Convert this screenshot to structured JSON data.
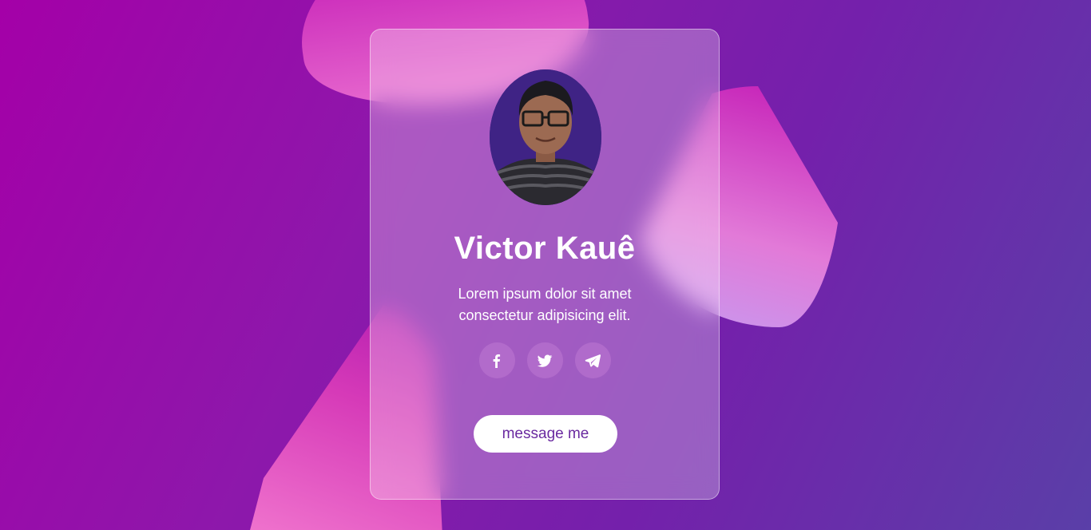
{
  "profile": {
    "name": "Victor Kauê",
    "bio_line1": "Lorem ipsum dolor sit amet",
    "bio_line2": "consectetur adipisicing elit.",
    "avatar_alt": "profile photo"
  },
  "socials": [
    {
      "icon": "facebook-icon"
    },
    {
      "icon": "twitter-icon"
    },
    {
      "icon": "telegram-icon"
    }
  ],
  "cta": {
    "label": "message me"
  },
  "colors": {
    "background_start": "#a400a8",
    "background_end": "#5a3fa8",
    "blob_pink": "#e86bcf",
    "button_text": "#6a2aa0"
  }
}
